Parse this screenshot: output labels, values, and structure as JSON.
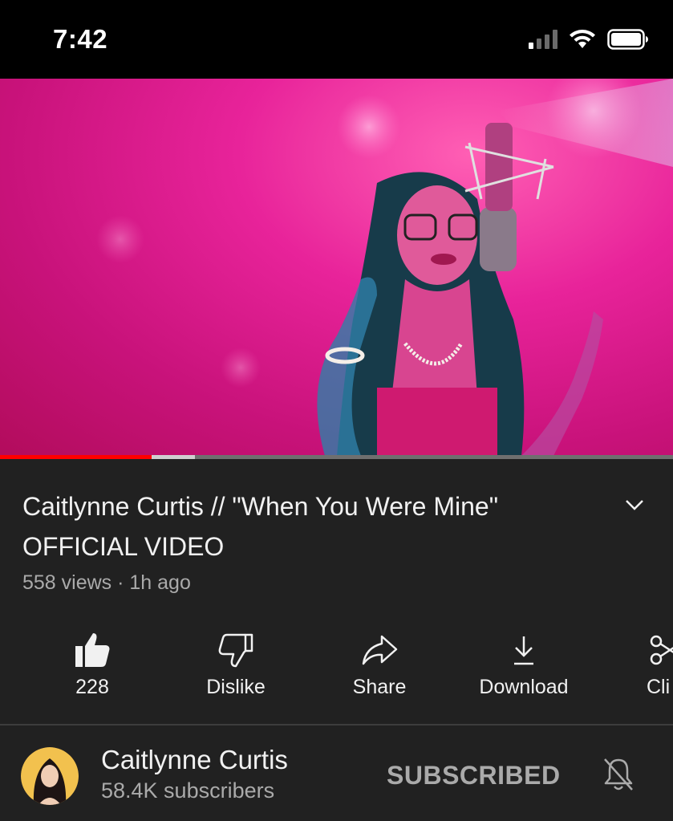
{
  "status_bar": {
    "time": "7:42"
  },
  "video": {
    "progress": 0.225,
    "buffered": 0.29
  },
  "title": "Caitlynne Curtis // \"When You Were Mine\" OFFICIAL VIDEO",
  "meta": "558 views · 1h ago",
  "actions": {
    "like": "228",
    "dislike": "Dislike",
    "share": "Share",
    "download": "Download",
    "clip": "Cli"
  },
  "channel": {
    "name": "Caitlynne Curtis",
    "subscribers": "58.4K subscribers",
    "subscribe_label": "SUBSCRIBED"
  },
  "colors": {
    "accent": "#ff0000",
    "background": "#212121",
    "text_secondary": "#aaaaaa"
  }
}
